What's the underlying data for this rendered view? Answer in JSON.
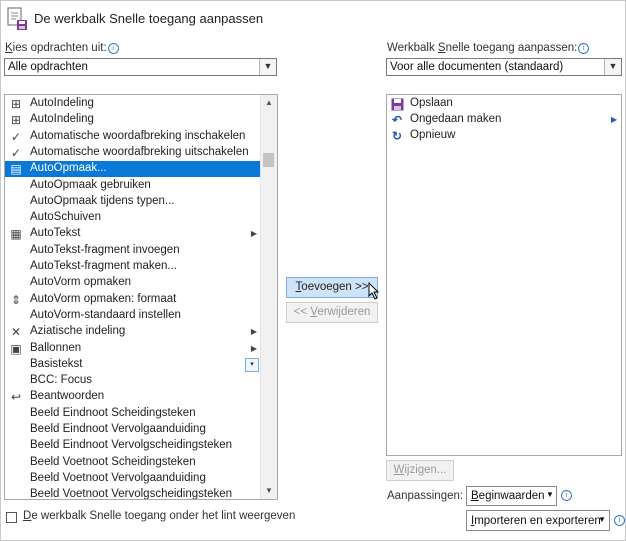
{
  "dialog": {
    "title": "De werkbalk Snelle toegang aanpassen"
  },
  "left": {
    "label_k": "K",
    "label_rest": "ies opdrachten uit:",
    "dropdown_value": "Alle opdrachten",
    "commands": [
      {
        "label": "AutoIndeling",
        "icon": "autofit-icon",
        "glyph": "⊞",
        "selected": false,
        "submenu": false
      },
      {
        "label": "AutoIndeling",
        "icon": "autofit-icon",
        "glyph": "⊞",
        "selected": false,
        "submenu": false
      },
      {
        "label": "Automatische woordafbreking inschakelen",
        "icon": "check-icon",
        "glyph": "✓",
        "selected": false,
        "submenu": false
      },
      {
        "label": "Automatische woordafbreking uitschakelen",
        "icon": "check-icon",
        "glyph": "✓",
        "selected": false,
        "submenu": false
      },
      {
        "label": "AutoOpmaak...",
        "icon": "autoformat-icon",
        "glyph": "▤",
        "selected": true,
        "submenu": false
      },
      {
        "label": "AutoOpmaak gebruiken",
        "icon": "",
        "glyph": "",
        "selected": false,
        "submenu": false
      },
      {
        "label": "AutoOpmaak tijdens typen...",
        "icon": "",
        "glyph": "",
        "selected": false,
        "submenu": false
      },
      {
        "label": "AutoSchuiven",
        "icon": "",
        "glyph": "",
        "selected": false,
        "submenu": false
      },
      {
        "label": "AutoTekst",
        "icon": "autotext-icon",
        "glyph": "▦",
        "selected": false,
        "submenu": true
      },
      {
        "label": "AutoTekst-fragment invoegen",
        "icon": "",
        "glyph": "",
        "selected": false,
        "submenu": false
      },
      {
        "label": "AutoTekst-fragment maken...",
        "icon": "",
        "glyph": "",
        "selected": false,
        "submenu": false
      },
      {
        "label": "AutoVorm opmaken",
        "icon": "",
        "glyph": "",
        "selected": false,
        "submenu": false
      },
      {
        "label": "AutoVorm opmaken: formaat",
        "icon": "shape-size-icon",
        "glyph": "⇕",
        "selected": false,
        "submenu": false
      },
      {
        "label": "AutoVorm-standaard instellen",
        "icon": "",
        "glyph": "",
        "selected": false,
        "submenu": false
      },
      {
        "label": "Aziatische indeling",
        "icon": "asian-layout-icon",
        "glyph": "✕",
        "selected": false,
        "submenu": true
      },
      {
        "label": "Ballonnen",
        "icon": "balloons-icon",
        "glyph": "▣",
        "selected": false,
        "submenu": true
      },
      {
        "label": "Basistekst",
        "icon": "",
        "glyph": "",
        "selected": false,
        "submenu": false,
        "dropdown": true
      },
      {
        "label": "BCC: Focus",
        "icon": "",
        "glyph": "",
        "selected": false,
        "submenu": false
      },
      {
        "label": "Beantwoorden",
        "icon": "reply-icon",
        "glyph": "↩",
        "selected": false,
        "submenu": false
      },
      {
        "label": "Beeld Eindnoot Scheidingsteken",
        "icon": "",
        "glyph": "",
        "selected": false,
        "submenu": false
      },
      {
        "label": "Beeld Eindnoot Vervolgaanduiding",
        "icon": "",
        "glyph": "",
        "selected": false,
        "submenu": false
      },
      {
        "label": "Beeld Eindnoot Vervolgscheidingsteken",
        "icon": "",
        "glyph": "",
        "selected": false,
        "submenu": false
      },
      {
        "label": "Beeld Voetnoot Scheidingsteken",
        "icon": "",
        "glyph": "",
        "selected": false,
        "submenu": false
      },
      {
        "label": "Beeld Voetnoot Vervolgaanduiding",
        "icon": "",
        "glyph": "",
        "selected": false,
        "submenu": false
      },
      {
        "label": "Beeld Voetnoot Vervolgscheidingsteken",
        "icon": "",
        "glyph": "",
        "selected": false,
        "submenu": false
      }
    ]
  },
  "middle": {
    "add_u": "T",
    "add_rest": "oevoegen >>",
    "remove_pre": "<< ",
    "remove_u": "V",
    "remove_rest": "erwijderen"
  },
  "right": {
    "label_pre": "Werkbalk ",
    "label_u": "S",
    "label_rest": "nelle toegang aanpassen:",
    "dropdown_value": "Voor alle documenten (standaard)",
    "items": [
      {
        "label": "Opslaan",
        "icon": "save-icon",
        "glyph": "💾",
        "submenu": false
      },
      {
        "label": "Ongedaan maken",
        "icon": "undo-icon",
        "glyph": "↶",
        "submenu": true
      },
      {
        "label": "Opnieuw",
        "icon": "redo-icon",
        "glyph": "↻",
        "submenu": false
      }
    ],
    "modify_u": "W",
    "modify_rest": "ijzigen...",
    "customizations_label": "Aanpassingen:",
    "reset_u": "B",
    "reset_rest": "eginwaarden",
    "import_u": "I",
    "import_rest": "mporteren en exporteren"
  },
  "footer": {
    "checkbox_u": "D",
    "checkbox_rest": "e werkbalk Snelle toegang onder het lint weergeven",
    "checked": false
  },
  "colors": {
    "selection": "#0a78d7",
    "info": "#3a77c6"
  }
}
